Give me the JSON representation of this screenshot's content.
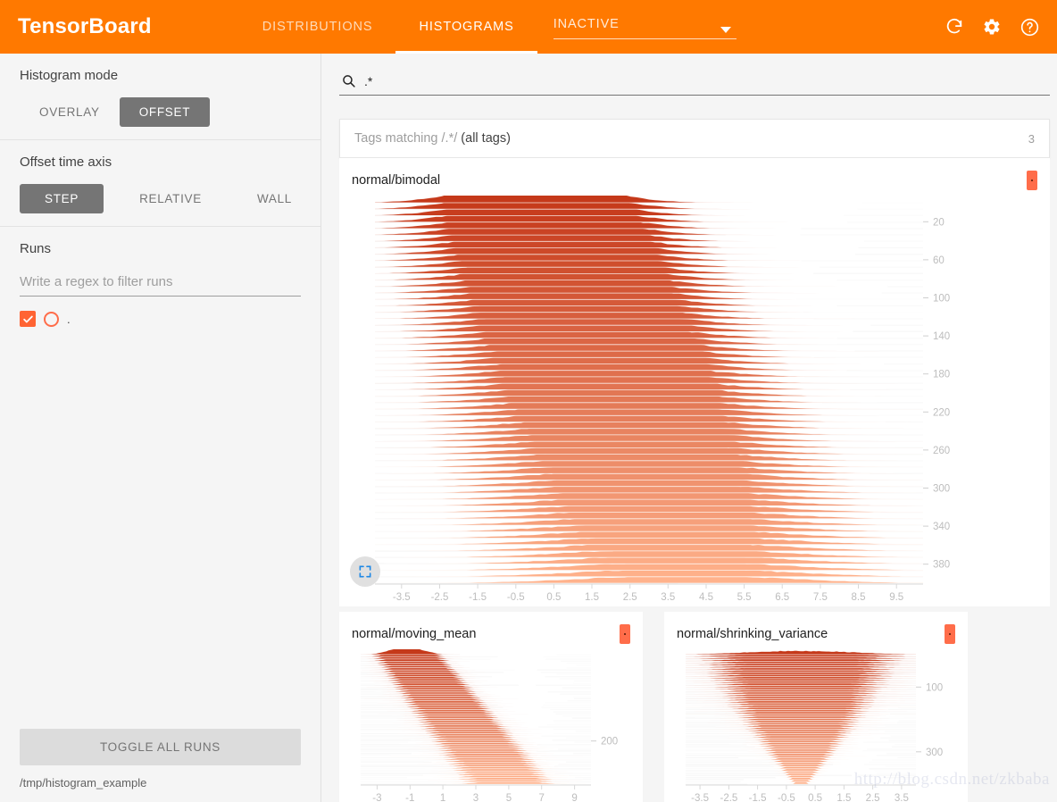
{
  "app": {
    "title": "TensorBoard",
    "accent": "#ff7900",
    "run_color": "#ff6d4a"
  },
  "header": {
    "tabs": [
      {
        "label": "DISTRIBUTIONS",
        "active": false
      },
      {
        "label": "HISTOGRAMS",
        "active": true
      }
    ],
    "inactive_dropdown": {
      "label": "INACTIVE"
    },
    "actions": [
      {
        "name": "refresh-icon",
        "title": "Refresh"
      },
      {
        "name": "settings-icon",
        "title": "Settings"
      },
      {
        "name": "help-icon",
        "title": "Help"
      }
    ]
  },
  "sidebar": {
    "histogram_mode": {
      "title": "Histogram mode",
      "options": [
        "OVERLAY",
        "OFFSET"
      ],
      "selected": "OFFSET"
    },
    "offset_time_axis": {
      "title": "Offset time axis",
      "options": [
        "STEP",
        "RELATIVE",
        "WALL"
      ],
      "selected": "STEP"
    },
    "runs": {
      "title": "Runs",
      "filter_placeholder": "Write a regex to filter runs",
      "filter_value": "",
      "items": [
        {
          "name": ".",
          "checked": true,
          "color": "#ff6d4a"
        }
      ]
    },
    "toggle_all_label": "TOGGLE ALL RUNS",
    "logdir": "/tmp/histogram_example"
  },
  "main": {
    "search": {
      "value": ".*",
      "placeholder": ""
    },
    "tags_header": {
      "prefix": "Tags matching ",
      "regex": "/.*/ ",
      "suffix": "(all tags)",
      "count": "3"
    },
    "watermark": "http://blog.csdn.net/zkbaba"
  },
  "chart_data": [
    {
      "type": "area",
      "title": "normal/bimodal",
      "subtype": "ridgeline-histogram-offset",
      "xlabel": "",
      "ylabel": "",
      "xlim": [
        -4.2,
        10.2
      ],
      "ylim": [
        0,
        400
      ],
      "xticks": [
        -3.5,
        -2.5,
        -1.5,
        -0.5,
        0.5,
        1.5,
        2.5,
        3.5,
        4.5,
        5.5,
        6.5,
        7.5,
        8.5,
        9.5
      ],
      "yticks": [
        20,
        60,
        100,
        140,
        180,
        220,
        260,
        300,
        340,
        380
      ],
      "grid": true,
      "legend": "none",
      "slices": 60,
      "series": [
        {
          "name": "step-ridges",
          "mode": "center-drift",
          "center_start": 0.0,
          "center_end": 4.0,
          "width_start": 1.6,
          "width_end": 2.6,
          "peak_start": 0.95,
          "peak_end": 0.35
        }
      ]
    },
    {
      "type": "area",
      "title": "normal/moving_mean",
      "subtype": "ridgeline-histogram-offset",
      "xlabel": "",
      "ylabel": "",
      "xlim": [
        -4,
        10
      ],
      "ylim": [
        0,
        300
      ],
      "xticks": [
        -3,
        -1,
        1,
        3,
        5,
        7,
        9
      ],
      "yticks": [
        200
      ],
      "grid": true,
      "legend": "none",
      "slices": 60,
      "series": [
        {
          "name": "step-ridges",
          "mode": "center-drift",
          "center_start": -1.2,
          "center_end": 5.0,
          "width_start": 1.0,
          "width_end": 1.5,
          "peak_start": 1.0,
          "peak_end": 0.55
        }
      ]
    },
    {
      "type": "area",
      "title": "normal/shrinking_variance",
      "subtype": "ridgeline-histogram-offset",
      "xlabel": "",
      "ylabel": "",
      "xlim": [
        -4,
        4
      ],
      "ylim": [
        0,
        400
      ],
      "xticks": [
        -3.5,
        -2.5,
        -1.5,
        -0.5,
        0.5,
        1.5,
        2.5,
        3.5
      ],
      "yticks": [
        100,
        300
      ],
      "grid": true,
      "legend": "none",
      "slices": 60,
      "series": [
        {
          "name": "step-ridges",
          "mode": "variance-shrink",
          "center_start": 0.0,
          "center_end": 0.0,
          "width_start": 2.0,
          "width_end": 0.12,
          "peak_start": 0.5,
          "peak_end": 1.0
        }
      ]
    }
  ]
}
